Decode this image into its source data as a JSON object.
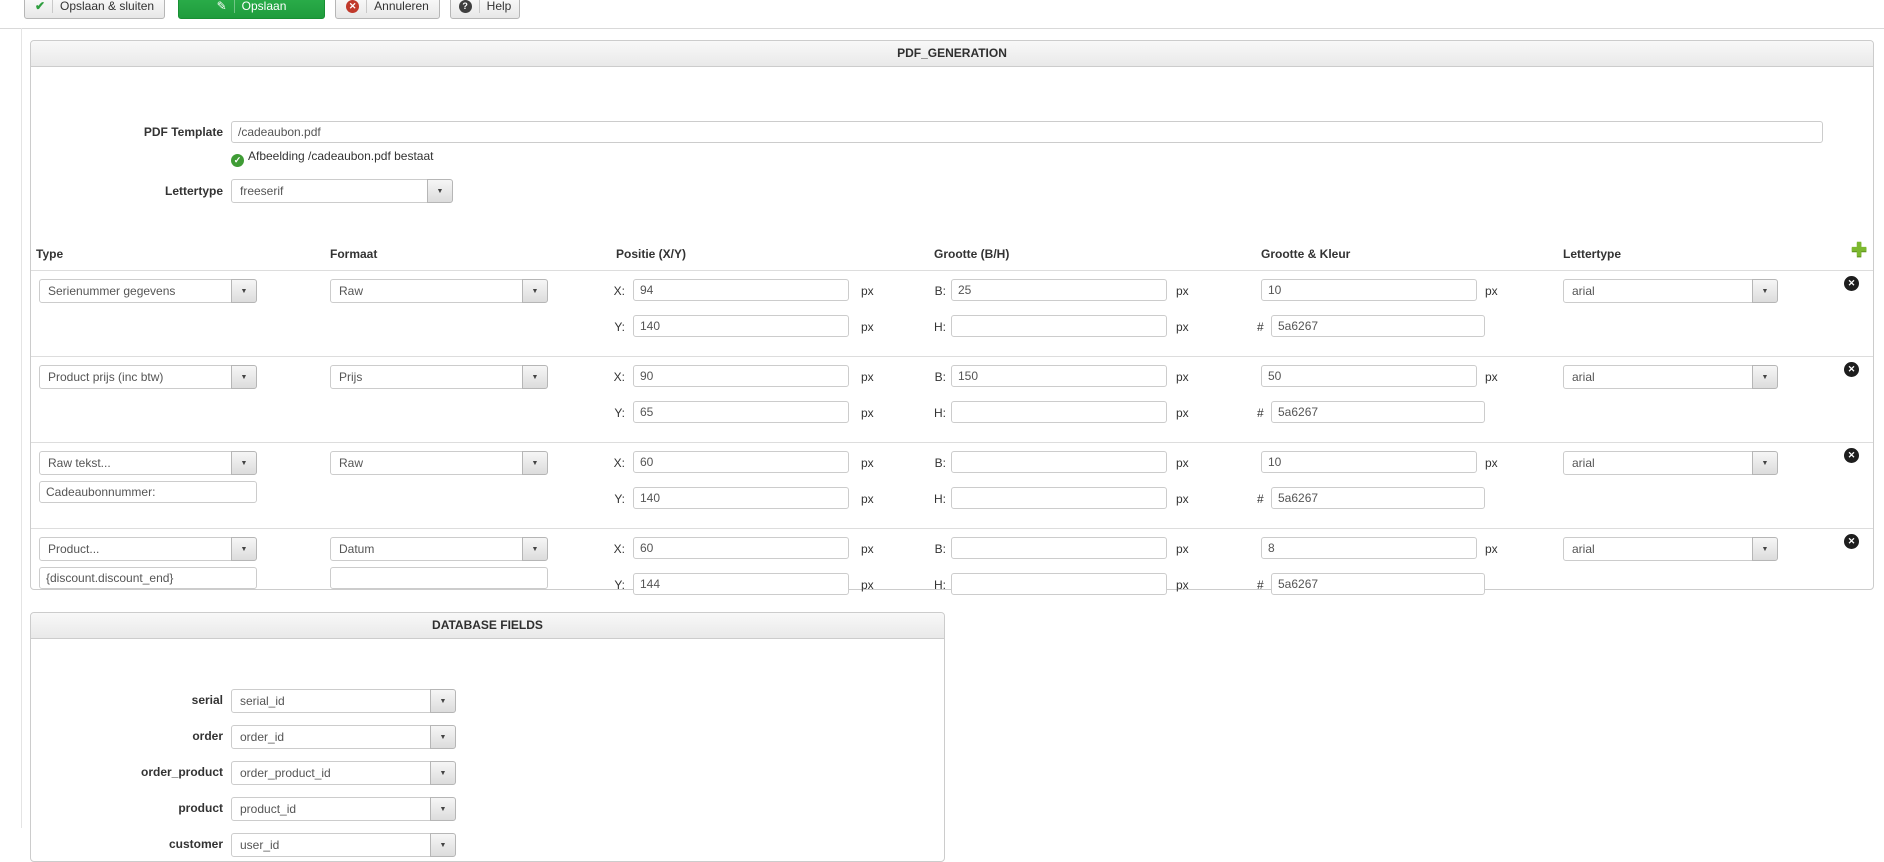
{
  "toolbar": {
    "save_close_label": "Opslaan & sluiten",
    "save_label": "Opslaan",
    "cancel_label": "Annuleren",
    "help_label": "Help"
  },
  "pdf_generation": {
    "title": "PDF_GENERATION",
    "pdf_template_label": "PDF Template",
    "pdf_template_value": "/cadeaubon.pdf",
    "file_status": "Afbeelding /cadeaubon.pdf bestaat",
    "lettertype_label": "Lettertype",
    "lettertype_value": "freeserif",
    "columns": [
      "Type",
      "Formaat",
      "Positie (X/Y)",
      "Grootte (B/H)",
      "Grootte & Kleur",
      "Lettertype"
    ],
    "labels": {
      "x": "X:",
      "y": "Y:",
      "b": "B:",
      "h": "H:",
      "px": "px",
      "hash": "#"
    },
    "rows": [
      {
        "type": "Serienummer gegevens",
        "formaat": "Raw",
        "x": "94",
        "y": "140",
        "b": "25",
        "h": "",
        "size": "10",
        "color": "5a6267",
        "font": "arial"
      },
      {
        "type": "Product prijs (inc btw)",
        "formaat": "Prijs",
        "x": "90",
        "y": "65",
        "b": "150",
        "h": "",
        "size": "50",
        "color": "5a6267",
        "font": "arial"
      },
      {
        "type": "Raw tekst...",
        "type_text": "Cadeaubonnummer:",
        "formaat": "Raw",
        "x": "60",
        "y": "140",
        "b": "",
        "h": "",
        "size": "10",
        "color": "5a6267",
        "font": "arial"
      },
      {
        "type": "Product...",
        "type_text": "{discount.discount_end}",
        "formaat": "Datum",
        "formaat_text": "",
        "x": "60",
        "y": "144",
        "b": "",
        "h": "",
        "size": "8",
        "color": "5a6267",
        "font": "arial"
      }
    ]
  },
  "database_fields": {
    "title": "DATABASE FIELDS",
    "fields": [
      {
        "label": "serial",
        "value": "serial_id"
      },
      {
        "label": "order",
        "value": "order_id"
      },
      {
        "label": "order_product",
        "value": "order_product_id"
      },
      {
        "label": "product",
        "value": "product_id"
      },
      {
        "label": "customer",
        "value": "user_id"
      }
    ]
  },
  "colors": {
    "primary_button": "#27a243",
    "check_icon": "#2f9e3f",
    "status_icon": "#3f9c35",
    "cancel_icon": "#c0392b",
    "help_icon": "#3f3f3f",
    "add_icon": "#7cb82f",
    "row_color_value": "#5a6267"
  }
}
